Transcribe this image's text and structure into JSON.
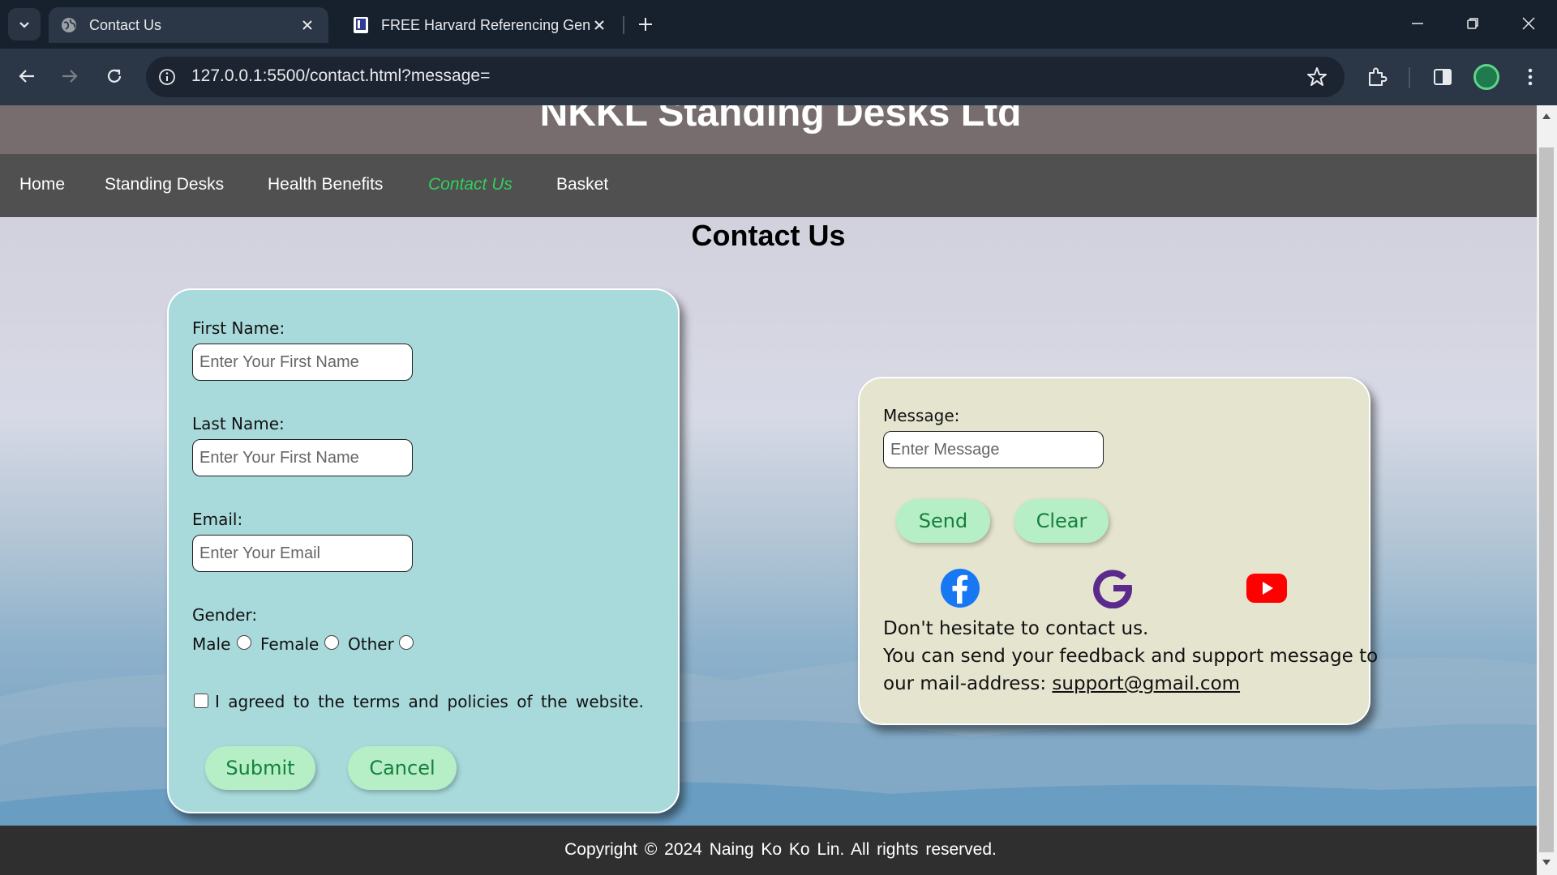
{
  "browser": {
    "tabs": [
      {
        "title": "Contact Us",
        "active": true
      },
      {
        "title": "FREE Harvard Referencing Generator",
        "active": false
      }
    ],
    "url": "127.0.0.1:5500/contact.html?message=",
    "icons": [
      "tab-list-icon",
      "globe-icon",
      "close-icon",
      "book-icon",
      "plus-icon",
      "minimize-icon",
      "restore-icon",
      "window-close-icon",
      "back-icon",
      "forward-icon",
      "reload-icon",
      "site-info-icon",
      "star-icon",
      "extensions-icon",
      "side-panel-icon",
      "profile-avatar",
      "menu-icon"
    ]
  },
  "site": {
    "title": "NKKL Standing Desks Ltd",
    "nav": [
      "Home",
      "Standing Desks",
      "Health Benefits",
      "Contact Us",
      "Basket"
    ],
    "current_nav": "Contact Us",
    "accent_color": "#31d05b"
  },
  "page": {
    "heading": "Contact Us"
  },
  "contact_form": {
    "first_name_label": "First Name:",
    "first_name_placeholder": "Enter Your First Name",
    "last_name_label": "Last Name:",
    "last_name_placeholder": "Enter Your First Name",
    "email_label": "Email:",
    "email_placeholder": "Enter Your Email",
    "gender_label": "Gender:",
    "gender_options": [
      "Male",
      "Female",
      "Other"
    ],
    "terms_text": "I agreed to the terms and policies of the website.",
    "submit_label": "Submit",
    "cancel_label": "Cancel"
  },
  "message_box": {
    "message_label": "Message:",
    "message_placeholder": "Enter Message",
    "send_label": "Send",
    "clear_label": "Clear",
    "social_icons": [
      "facebook-icon",
      "google-icon",
      "youtube-icon"
    ],
    "line1": "Don't hesitate to contact us.",
    "line2": "You can send your feedback and support message to",
    "line3_prefix": "our mail-address: ",
    "email": "support@gmail.com"
  },
  "footer": {
    "text": "Copyright ©  2024 Naing Ko Ko Lin. All rights reserved."
  }
}
